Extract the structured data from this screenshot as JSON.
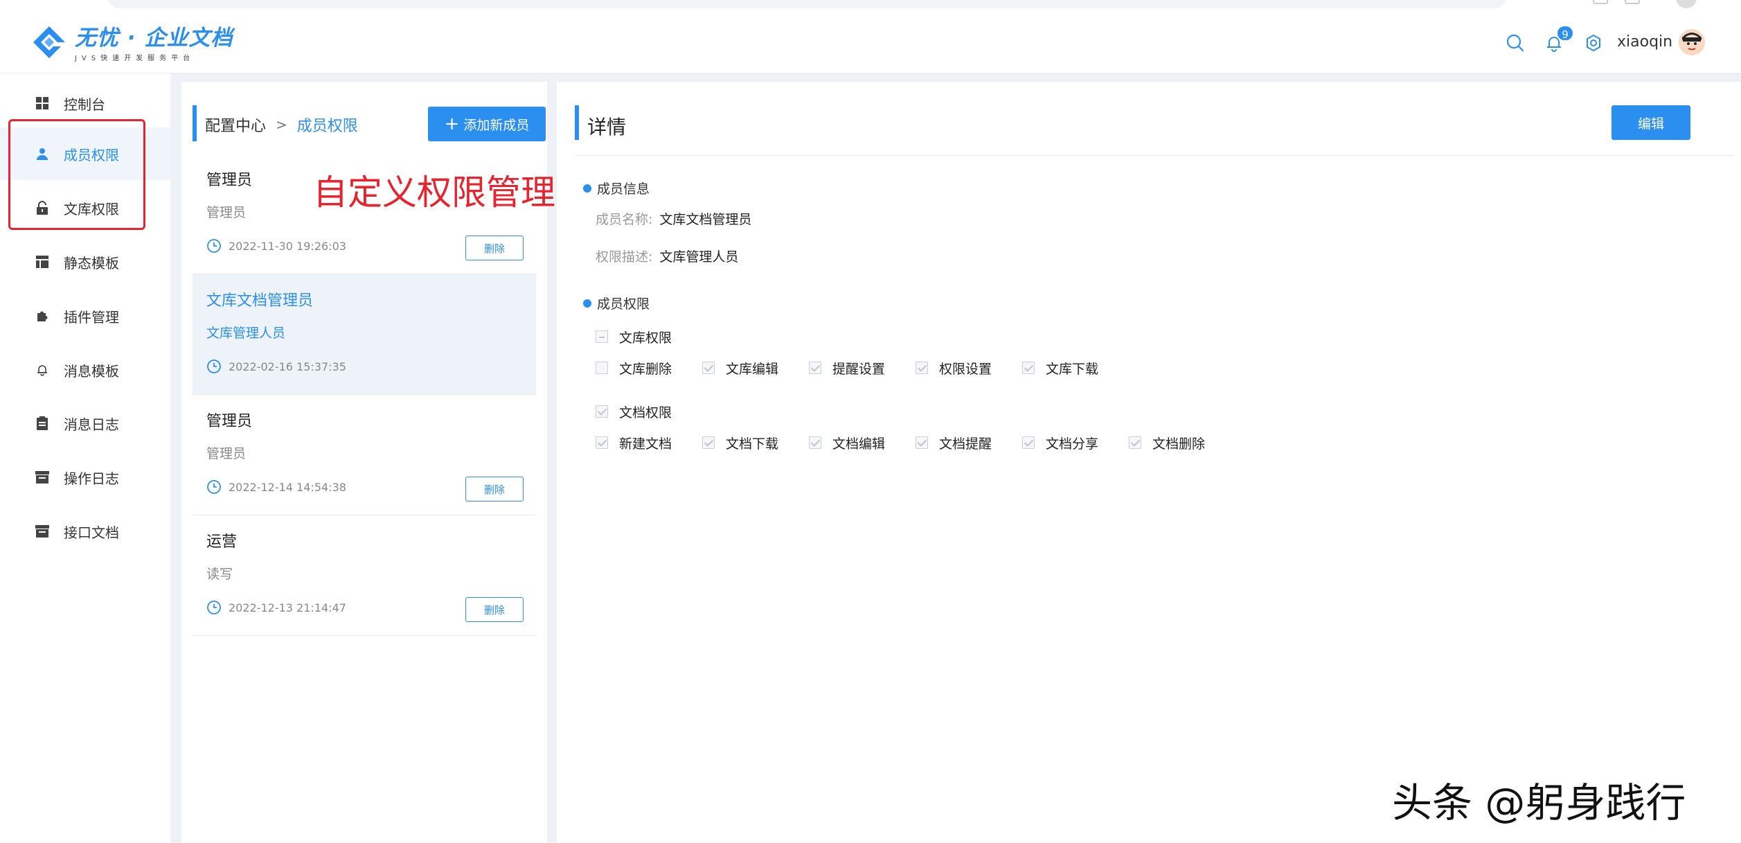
{
  "header": {
    "logo_title": "无忧 · 企业文档",
    "logo_subtitle": "JVS快速开发服务平台",
    "notification_count": "9",
    "username": "xiaoqin"
  },
  "colors": {
    "accent": "#2b8ff0",
    "annotation": "#e8232e"
  },
  "sidebar": {
    "items": [
      {
        "label": "控制台",
        "icon": "dashboard-grid-icon"
      },
      {
        "label": "成员权限",
        "icon": "user-icon",
        "active": true
      },
      {
        "label": "文库权限",
        "icon": "lock-icon"
      },
      {
        "label": "静态模板",
        "icon": "template-icon"
      },
      {
        "label": "插件管理",
        "icon": "puzzle-icon"
      },
      {
        "label": "消息模板",
        "icon": "bell-icon"
      },
      {
        "label": "消息日志",
        "icon": "clipboard-icon"
      },
      {
        "label": "操作日志",
        "icon": "archive-icon"
      },
      {
        "label": "接口文档",
        "icon": "archive-icon"
      }
    ]
  },
  "list": {
    "breadcrumb_root": "配置中心",
    "breadcrumb_current": "成员权限",
    "add_button": "添加新成员",
    "delete_label": "删除",
    "members": [
      {
        "name": "管理员",
        "desc": "管理员",
        "time": "2022-11-30 19:26:03",
        "selected": false
      },
      {
        "name": "文库文档管理员",
        "desc": "文库管理人员",
        "time": "2022-02-16 15:37:35",
        "selected": true
      },
      {
        "name": "管理员",
        "desc": "管理员",
        "time": "2022-12-14 14:54:38",
        "selected": false
      },
      {
        "name": "运营",
        "desc": "读写",
        "time": "2022-12-13 21:14:47",
        "selected": false
      }
    ]
  },
  "annotation": "自定义权限管理",
  "detail": {
    "title": "详情",
    "edit_button": "编辑",
    "info_section": "成员信息",
    "name_label": "成员名称:",
    "name_value": "文库文档管理员",
    "desc_label": "权限描述:",
    "desc_value": "文库管理人员",
    "perm_section": "成员权限",
    "groups": [
      {
        "label": "文库权限",
        "state": "indeterminate",
        "items": [
          {
            "label": "文库删除",
            "checked": false
          },
          {
            "label": "文库编辑",
            "checked": true
          },
          {
            "label": "提醒设置",
            "checked": true
          },
          {
            "label": "权限设置",
            "checked": true
          },
          {
            "label": "文库下载",
            "checked": true
          }
        ]
      },
      {
        "label": "文档权限",
        "state": "checked",
        "items": [
          {
            "label": "新建文档",
            "checked": true
          },
          {
            "label": "文档下载",
            "checked": true
          },
          {
            "label": "文档编辑",
            "checked": true
          },
          {
            "label": "文档提醒",
            "checked": true
          },
          {
            "label": "文档分享",
            "checked": true
          },
          {
            "label": "文档删除",
            "checked": true
          }
        ]
      }
    ]
  },
  "watermark": "头条 @躬身践行"
}
